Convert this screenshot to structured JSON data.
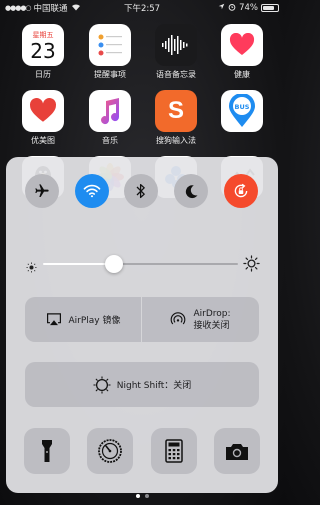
{
  "status_bar": {
    "carrier": "中国联通",
    "time": "下午2:57",
    "battery_percent": "74%",
    "battery_level": 0.74
  },
  "home_apps": [
    {
      "label": "日历",
      "date_weekday": "星期五",
      "date_day": "23"
    },
    {
      "label": "提醒事项"
    },
    {
      "label": "语音备忘录"
    },
    {
      "label": "健康"
    },
    {
      "label": "优美图"
    },
    {
      "label": "音乐"
    },
    {
      "label": "搜狗输入法"
    },
    {
      "label": "",
      "badge_text": "BUS"
    }
  ],
  "control_center": {
    "toggles": [
      {
        "name": "airplane-mode",
        "icon": "airplane-icon",
        "active": false
      },
      {
        "name": "wifi",
        "icon": "wifi-icon",
        "active": true,
        "color": "#1e8cf0"
      },
      {
        "name": "bluetooth",
        "icon": "bluetooth-icon",
        "active": false
      },
      {
        "name": "do-not-disturb",
        "icon": "moon-icon",
        "active": false
      },
      {
        "name": "rotation-lock",
        "icon": "rotation-lock-icon",
        "active": true,
        "color": "#f54a2c"
      }
    ],
    "brightness_level": 0.38,
    "airplay_label": "AirPlay 镜像",
    "airdrop_line1": "AirDrop:",
    "airdrop_line2": "接收关闭",
    "night_shift_label": "Night Shift：关闭",
    "bottom_buttons": [
      "flashlight-icon",
      "timer-icon",
      "calculator-icon",
      "camera-icon"
    ]
  },
  "pager": {
    "pages": 2,
    "current": 1
  }
}
